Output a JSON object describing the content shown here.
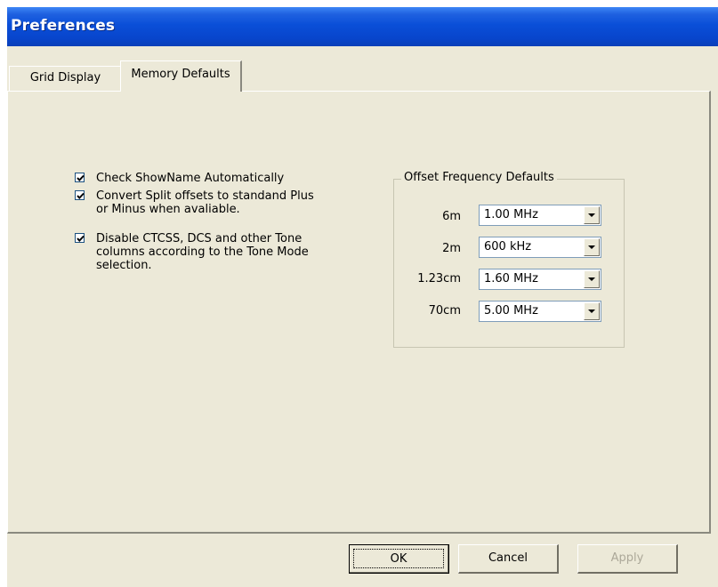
{
  "window": {
    "title": "Preferences"
  },
  "tabs": [
    {
      "label": "Grid Display",
      "active": false
    },
    {
      "label": "Memory Defaults",
      "active": true
    }
  ],
  "options": [
    {
      "line1": "Check ShowName Automatically",
      "line2": "",
      "line3": "",
      "checked": true
    },
    {
      "line1": "Convert Split offsets to standand Plus",
      "line2": "or Minus when avaliable.",
      "line3": "",
      "checked": true
    },
    {
      "line1": "Disable CTCSS, DCS and other Tone",
      "line2": "columns according to the Tone Mode",
      "line3": "selection.",
      "checked": true
    }
  ],
  "offset_group": {
    "title": "Offset Frequency Defaults",
    "rows": [
      {
        "band": "6m",
        "value": "1.00 MHz"
      },
      {
        "band": "2m",
        "value": "600 kHz"
      },
      {
        "band": "1.23cm",
        "value": "1.60 MHz"
      },
      {
        "band": "70cm",
        "value": "5.00 MHz"
      }
    ]
  },
  "buttons": {
    "ok": "OK",
    "cancel": "Cancel",
    "apply": "Apply",
    "apply_enabled": false
  },
  "colors": {
    "title_bar": "#0a4fd8",
    "window_bg": "#ece9d8",
    "disabled_text": "#aca899"
  }
}
